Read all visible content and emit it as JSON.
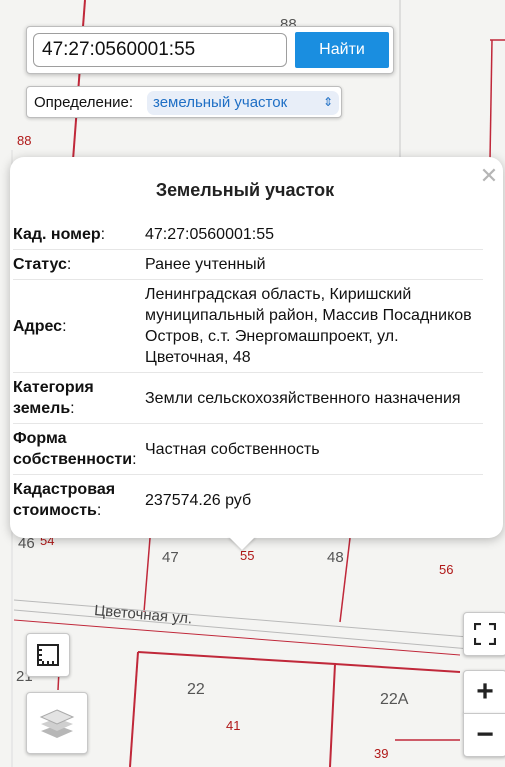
{
  "search": {
    "value": "47:27:0560001:55",
    "button_label": "Найти"
  },
  "definition": {
    "label": "Определение:",
    "selected": "земельный участок"
  },
  "popup": {
    "title": "Земельный участок",
    "rows": [
      {
        "key": "Кад. номер",
        "value": "47:27:0560001:55"
      },
      {
        "key": "Статус",
        "value": "Ранее учтенный"
      },
      {
        "key": "Адрес",
        "value": "Ленинградская область, Киришский муниципальный район, Массив Посадников Остров, с.т. Энергомашпроект, ул. Цветочная, 48"
      },
      {
        "key": "Категория земель",
        "value": "Земли сельскохозяйственного назначения"
      },
      {
        "key": "Форма собственности",
        "value": "Частная собственность"
      },
      {
        "key": "Кадастровая стоимость",
        "value": "237574.26 руб"
      }
    ]
  },
  "map": {
    "labels": [
      "88",
      "88",
      "46",
      "54",
      "47",
      "55",
      "48",
      "56",
      "22",
      "41",
      "22А",
      "39",
      "21"
    ],
    "street": "Цветочная ул."
  },
  "controls": {
    "zoom_in": "+",
    "zoom_out": "−"
  }
}
